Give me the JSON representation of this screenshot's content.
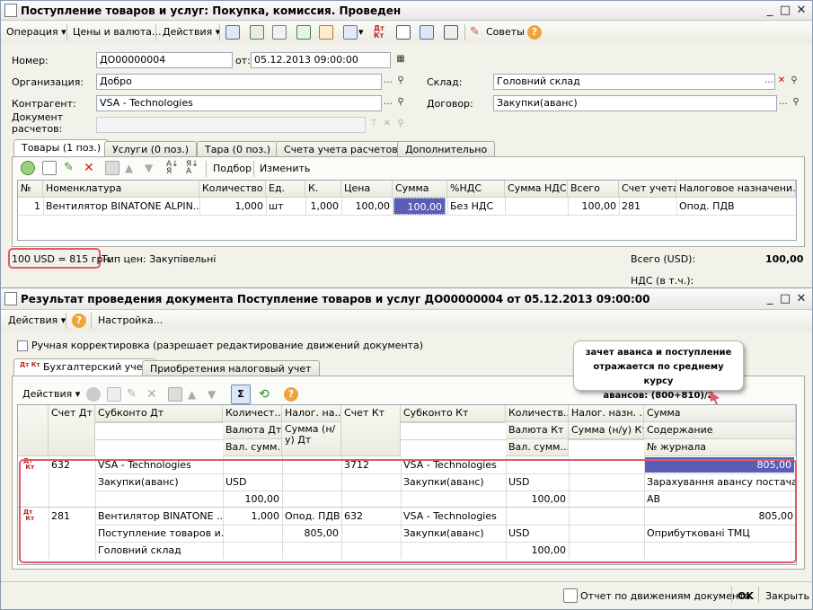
{
  "win1": {
    "title": "Поступление товаров и услуг: Покупка, комиссия. Проведен",
    "toolbar": {
      "operation": "Операция",
      "prices": "Цены и валюта...",
      "actions": "Действия",
      "advice": "Советы"
    },
    "form": {
      "number_label": "Номер:",
      "number": "ДО00000004",
      "from_label": "от:",
      "date": "05.12.2013 09:00:00",
      "org_label": "Организация:",
      "org": "Добро",
      "warehouse_label": "Склад:",
      "warehouse": "Головний склад",
      "contractor_label": "Контрагент:",
      "contractor": "VSA - Technologies",
      "contract_label": "Договор:",
      "contract": "Закупки(аванс)",
      "doc_label1": "Документ",
      "doc_label2": "расчетов:",
      "doc": ""
    },
    "tabs": [
      "Товары (1 поз.)",
      "Услуги (0 поз.)",
      "Тара (0 поз.)",
      "Счета учета расчетов",
      "Дополнительно"
    ],
    "grid_toolbar": {
      "select": "Подбор",
      "change": "Изменить"
    },
    "columns": [
      "№",
      "Номенклатура",
      "Количество",
      "Ед.",
      "К.",
      "Цена",
      "Сумма",
      "%НДС",
      "Сумма НДС",
      "Всего",
      "Счет учета",
      "Налоговое назначени..."
    ],
    "row": [
      "1",
      "Вентилятор BINATONE ALPIN...",
      "1,000",
      "шт",
      "1,000",
      "100,00",
      "100,00",
      "Без НДС",
      "",
      "100,00",
      "281",
      "Опод. ПДВ"
    ],
    "rate": "100 USD = 815 грн.",
    "price_type": "Тип цен: Закупівельні",
    "total_label": "Всего (USD):",
    "total": "100,00",
    "vat_label": "НДС (в т.ч.):"
  },
  "win2": {
    "title": "Результат проведения документа Поступление товаров и услуг ДО00000004 от 05.12.2013 09:00:00",
    "toolbar": {
      "actions": "Действия",
      "settings": "Настройка..."
    },
    "manual": "Ручная корректировка (разрешает редактирование движений документа)",
    "tabs": [
      "Бухгалтерский учет",
      "Приобретения налоговый учет"
    ],
    "grid_actions": "Действия",
    "headers": {
      "acc_dt": "Счет Дт",
      "sub_dt": "Субконто Дт",
      "qty_dt": "Количест...",
      "qty_dt2": "Валюта Дт",
      "qty_dt3": "Вал. сумм...",
      "tax_dt": "Налог. на...",
      "tax_dt2": "Сумма (н/у) Дт",
      "acc_kt": "Счет Кт",
      "sub_kt": "Субконто Кт",
      "qty_kt": "Количеств...",
      "qty_kt2": "Валюта Кт",
      "qty_kt3": "Вал. сумм...",
      "tax_kt": "Налог. назн. ...",
      "tax_kt2": "Сумма (н/у) Кт",
      "sum": "Сумма",
      "sum2": "Содержание",
      "sum3": "№ журнала"
    },
    "rows": [
      {
        "acc_dt": "632",
        "sub_dt": [
          "VSA - Technologies",
          "Закупки(аванс)",
          ""
        ],
        "qty_dt": [
          "",
          "USD",
          "100,00"
        ],
        "tax_dt": [
          "",
          "",
          ""
        ],
        "acc_kt": "3712",
        "sub_kt": [
          "VSA - Technologies",
          "Закупки(аванс)",
          ""
        ],
        "qty_kt": [
          "",
          "USD",
          "100,00"
        ],
        "tax_kt": [
          "",
          "",
          ""
        ],
        "sum": [
          "805,00",
          "Зарахування авансу постачал...",
          "АВ"
        ]
      },
      {
        "acc_dt": "281",
        "sub_dt": [
          "Вентилятор BINATONE ...",
          "Поступление товаров и...",
          "Головний склад"
        ],
        "qty_dt": [
          "1,000",
          "",
          ""
        ],
        "tax_dt": [
          "Опод. ПДВ",
          "805,00",
          ""
        ],
        "acc_kt": "632",
        "sub_kt": [
          "VSA - Technologies",
          "Закупки(аванс)",
          ""
        ],
        "qty_kt": [
          "",
          "USD",
          "100,00"
        ],
        "tax_kt": [
          "",
          "",
          ""
        ],
        "sum": [
          "805,00",
          "Оприбутковані ТМЦ",
          ""
        ]
      }
    ],
    "callout": [
      "зачет аванса и поступление",
      "отражается по среднему курсу",
      "авансов: (800+810)/2"
    ],
    "report": "Отчет по движениям документа",
    "ok": "OK",
    "close": "Закрыть"
  },
  "colors": {
    "selected": "#5a5fb5",
    "highlight": "#e05a68",
    "title_bg": "#ececec"
  }
}
